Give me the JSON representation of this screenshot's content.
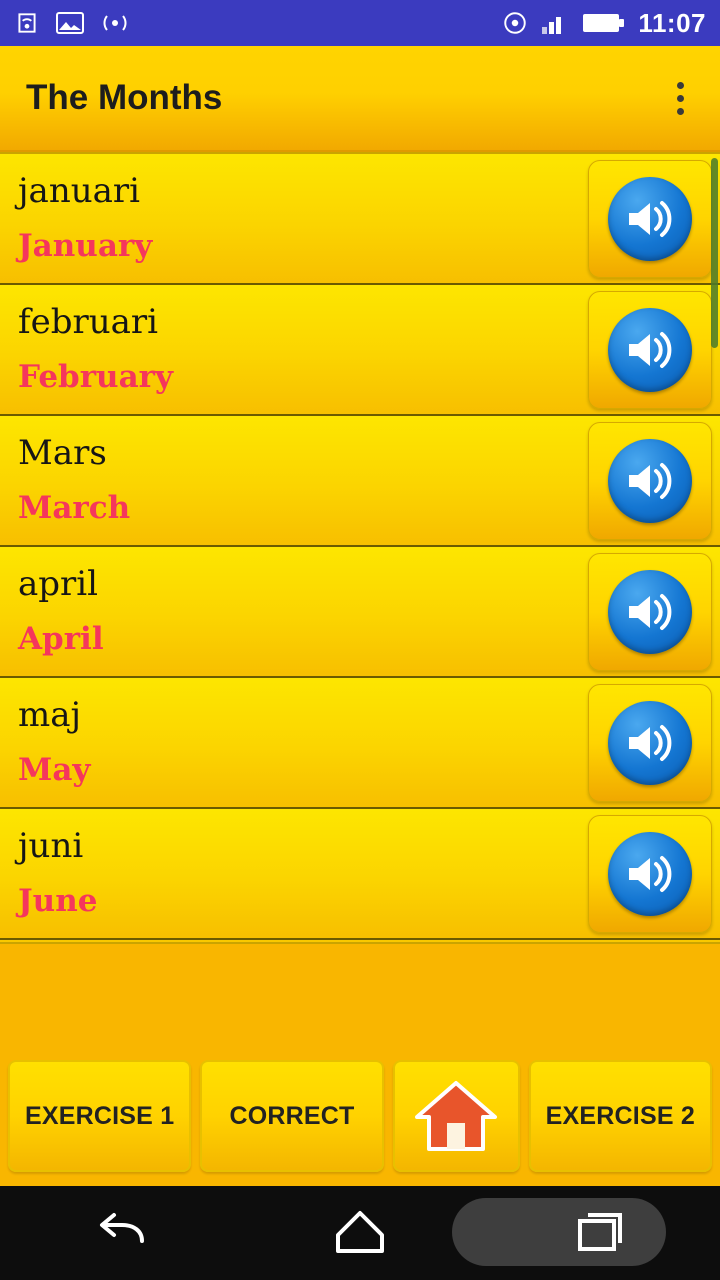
{
  "status_bar": {
    "icons": [
      "cast-icon",
      "image-icon",
      "wifi-broadcast-icon",
      "screen-share-icon",
      "signal-icon",
      "battery-icon"
    ],
    "clock": "11:07",
    "background_color": "#3b3bbf"
  },
  "action_bar": {
    "title": "The Months",
    "overflow_menu": "overflow-menu-icon"
  },
  "list": {
    "scrollbar": "vertical-scrollbar",
    "items": [
      {
        "word": "januari",
        "translation": "January",
        "speak": "speaker-icon"
      },
      {
        "word": "februari",
        "translation": "February",
        "speak": "speaker-icon"
      },
      {
        "word": "Mars",
        "translation": "March",
        "speak": "speaker-icon"
      },
      {
        "word": "april",
        "translation": "April",
        "speak": "speaker-icon"
      },
      {
        "word": "maj",
        "translation": "May",
        "speak": "speaker-icon"
      },
      {
        "word": "juni",
        "translation": "June",
        "speak": "speaker-icon"
      }
    ]
  },
  "bottom_bar": {
    "exercise1": "EXERCISE 1",
    "correct": "CORRECT",
    "home": "home-icon",
    "exercise2": "EXERCISE 2"
  },
  "nav_bar": {
    "back": "back-icon",
    "home": "home-icon",
    "recents": "recents-icon"
  },
  "colors": {
    "accent_yellow": "#ffd400",
    "row_yellow": "#fbd400",
    "translation_pink": "#f5365c",
    "status_blue": "#3b3bbf",
    "speaker_blue": "#1476d2"
  }
}
